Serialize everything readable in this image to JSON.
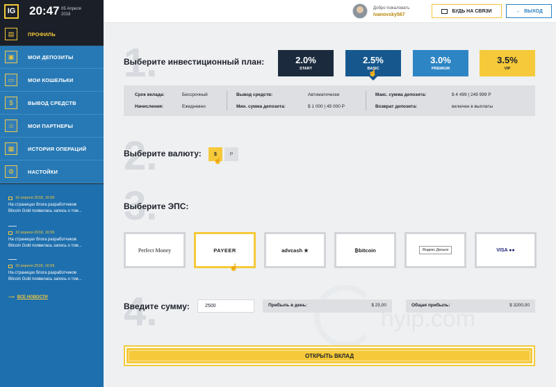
{
  "header": {
    "logo": "IG",
    "time": "20:47",
    "date_line1": "05 Апреля",
    "date_line2": "2018",
    "welcome": "Добро пожаловать",
    "username": "Ivanovsky567",
    "support_label": "БУДЬ НА СВЯЗИ",
    "logout_label": "ВЫХОД"
  },
  "sidebar": {
    "items": [
      {
        "label": "Профиль",
        "icon": "profile-icon"
      },
      {
        "label": "Мои депозиты",
        "icon": "deposits-icon"
      },
      {
        "label": "Мои кошельки",
        "icon": "wallet-icon"
      },
      {
        "label": "Вывод средств",
        "icon": "withdraw-icon"
      },
      {
        "label": "Мои партнеры",
        "icon": "partners-icon"
      },
      {
        "label": "История операций",
        "icon": "history-icon"
      },
      {
        "label": "Настойки",
        "icon": "settings-icon"
      }
    ],
    "news": [
      {
        "date": "10 апреля 2018, 16:56",
        "line1": "На страницах блога разработчиков",
        "line2": "Bitcoin Gold появилась запись о том..."
      },
      {
        "date": "10 апреля 2018, 16:56",
        "line1": "На страницах блога разработчиков",
        "line2": "Bitcoin Gold появилась запись о том..."
      },
      {
        "date": "10 апреля 2018, 16:56",
        "line1": "На страницах блога разработчиков",
        "line2": "Bitcoin Gold появилась запись о том..."
      }
    ],
    "all_news": "ВСЕ НОВОСТИ"
  },
  "step1": {
    "num": "1.",
    "title": "Выберите инвестиционный план:",
    "plans": [
      {
        "pct": "2.0%",
        "name": "START",
        "color": "#1b2a3d"
      },
      {
        "pct": "2.5%",
        "name": "BASIC",
        "color": "#16588e"
      },
      {
        "pct": "3.0%",
        "name": "PREMIUM",
        "color": "#2e85c4"
      },
      {
        "pct": "3.5%",
        "name": "VIP",
        "color": "#f5c93a"
      }
    ],
    "info": {
      "term_label": "Срок вклада:",
      "term_value": "Бессрочный",
      "accrual_label": "Начисления:",
      "accrual_value": "Ежедневно",
      "withdraw_label": "Вывод средств:",
      "withdraw_value": "Автоматически",
      "min_label": "Мин. сумма депозита:",
      "min_value": "$ 1 000 | 45 000 Р",
      "max_label": "Макс. сумма депозита:",
      "max_value": "$ 4 499 | 249 999 Р",
      "return_label": "Возврат депозита:",
      "return_value": "включен в выплаты"
    }
  },
  "step2": {
    "num": "2.",
    "title": "Выберите валюту:",
    "currencies": [
      "$",
      "Р"
    ]
  },
  "step3": {
    "num": "3.",
    "title": "Выберите ЭПС:",
    "systems": [
      "Perfect Money",
      "PAYEER",
      "advcash ★",
      "₿bitcoin",
      "Яндекс Деньги",
      "VISA ●●"
    ]
  },
  "step4": {
    "num": "4.",
    "title": "Введите сумму:",
    "amount": "2500",
    "daily_label": "Прибыль в день:",
    "daily_value": "$ 25,00",
    "total_label": "Общая прибыль:",
    "total_value": "$ 3200,00"
  },
  "submit_label": "ОТКРЫТЬ ВКЛАД",
  "watermark": "hyip.com",
  "colors": {
    "accent": "#f5c93a",
    "blue": "#2779b5",
    "dark": "#1b2028"
  }
}
